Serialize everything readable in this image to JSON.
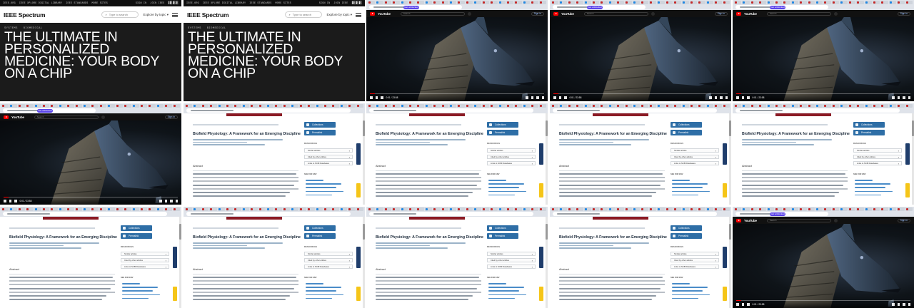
{
  "ieee": {
    "top_links": [
      "IEEE.ORG",
      "IEEE XPLORE DIGITAL LIBRARY",
      "IEEE STANDARDS",
      "MORE SITES"
    ],
    "top_right": [
      "SIGN IN",
      "JOIN IEEE"
    ],
    "logo": "IEEE",
    "brand": "IEEE Spectrum",
    "search_placeholder": "Type to search",
    "explore": "Explore by topic",
    "crumbs": [
      "SYSTEMS",
      "BIOMEDICAL"
    ],
    "headline": "THE ULTIMATE IN PERSONALIZED MEDICINE: YOUR BODY ON A CHIP"
  },
  "browser": {
    "badge": "Get unblocked"
  },
  "youtube": {
    "wordmark": "YouTube",
    "search_placeholder": "Search",
    "sign_in": "Sign in",
    "time": "0:01 / 23:58"
  },
  "paper": {
    "title": "Biofield Physiology: A Framework for an Emerging Discipline",
    "collections": "Collections",
    "permalink": "Permalink",
    "resources_label": "RESOURCES",
    "resources": [
      "Similar articles",
      "Cited by other articles",
      "Links to NCBI Databases"
    ],
    "abstract_label": "Abstract",
    "see_for": "SEE FOR ENV"
  },
  "tiles": [
    {
      "kind": "ieee"
    },
    {
      "kind": "ieee"
    },
    {
      "kind": "yt"
    },
    {
      "kind": "yt"
    },
    {
      "kind": "yt"
    },
    {
      "kind": "yt"
    },
    {
      "kind": "paper"
    },
    {
      "kind": "paper"
    },
    {
      "kind": "paper"
    },
    {
      "kind": "paper"
    },
    {
      "kind": "paper"
    },
    {
      "kind": "paper"
    },
    {
      "kind": "paper"
    },
    {
      "kind": "paper"
    },
    {
      "kind": "yt"
    }
  ]
}
